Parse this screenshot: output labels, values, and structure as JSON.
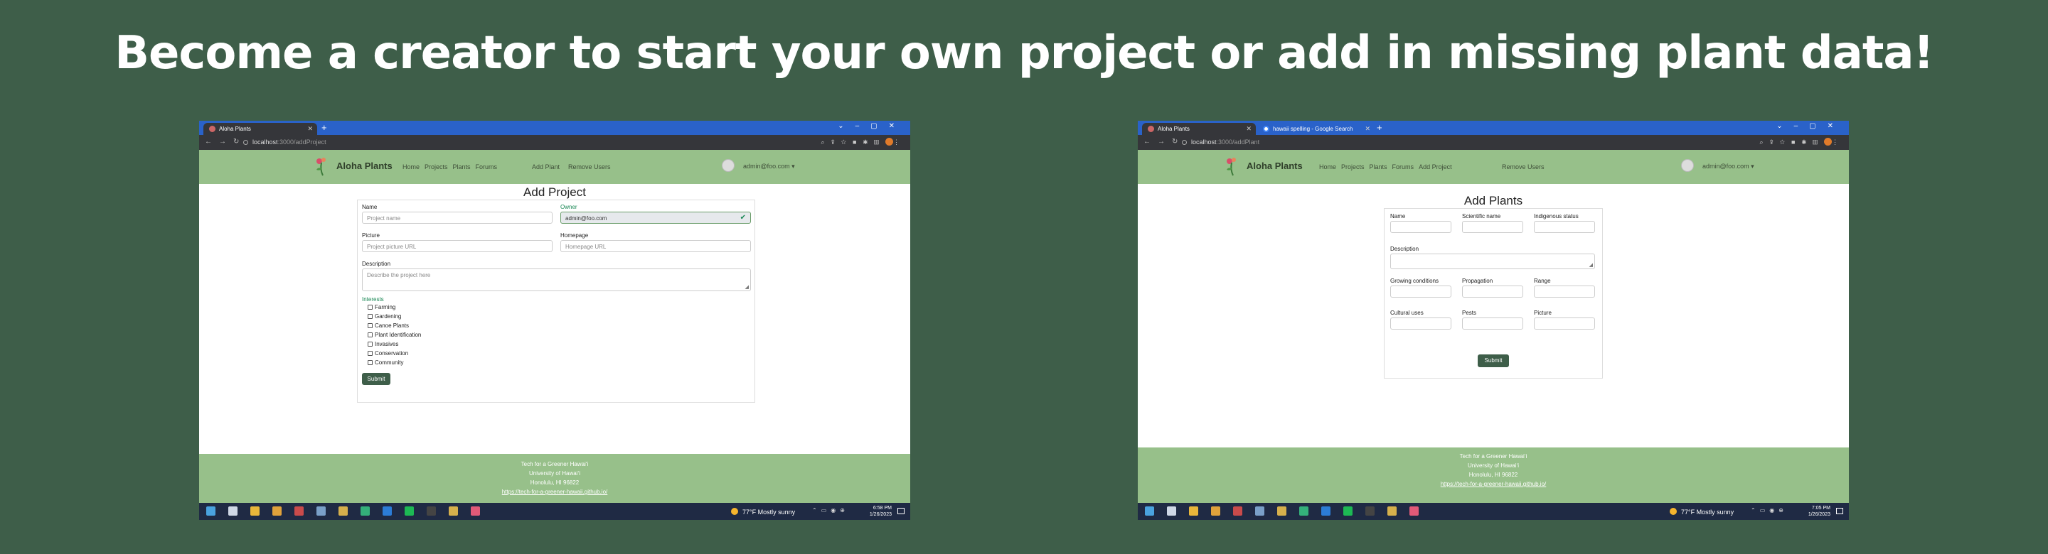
{
  "headline": "Become a creator to start your own project or add in missing plant data!",
  "left": {
    "tab_title": "Aloha Plants",
    "url_host": "localhost",
    "url_path": ":3000/addProject",
    "brand": "Aloha Plants",
    "nav": [
      "Home",
      "Projects",
      "Plants",
      "Forums"
    ],
    "nav_right": [
      "Add Plant",
      "Remove Users"
    ],
    "user": "admin@foo.com ▾",
    "page_title": "Add Project",
    "form": {
      "name_label": "Name",
      "name_placeholder": "Project name",
      "owner_label": "Owner",
      "owner_value": "admin@foo.com",
      "picture_label": "Picture",
      "picture_placeholder": "Project picture URL",
      "homepage_label": "Homepage",
      "homepage_placeholder": "Homepage URL",
      "description_label": "Description",
      "description_placeholder": "Describe the project here",
      "interests_label": "Interests",
      "interests": [
        "Farming",
        "Gardening",
        "Canoe Plants",
        "Plant Identification",
        "Invasives",
        "Conservation",
        "Community"
      ],
      "submit": "Submit"
    },
    "footer": [
      "Tech for a Greener Hawaiʻi",
      "University of Hawaiʻi",
      "Honolulu, HI 96822",
      "https://tech-for-a-greener-hawaii.github.io/"
    ],
    "weather": "77°F  Mostly sunny",
    "time": "6:58 PM",
    "date": "1/26/2023"
  },
  "right": {
    "tab_title": "Aloha Plants",
    "tab2_title": "hawaii spelling - Google Search",
    "url_host": "localhost",
    "url_path": ":3000/addPlant",
    "brand": "Aloha Plants",
    "nav": [
      "Home",
      "Projects",
      "Plants",
      "Forums",
      "Add Project"
    ],
    "nav_right": [
      "Remove Users"
    ],
    "user": "admin@foo.com ▾",
    "page_title": "Add Plants",
    "form": {
      "name_label": "Name",
      "scientific_label": "Scientific name",
      "indigenous_label": "Indigenous status",
      "description_label": "Description",
      "growing_label": "Growing conditions",
      "propagation_label": "Propagation",
      "range_label": "Range",
      "cultural_label": "Cultural uses",
      "pests_label": "Pests",
      "picture_label": "Picture",
      "submit": "Submit"
    },
    "footer": [
      "Tech for a Greener Hawaiʻi",
      "University of Hawaiʻi",
      "Honolulu, HI 96822",
      "https://tech-for-a-greener-hawaii.github.io/"
    ],
    "weather": "77°F  Mostly sunny",
    "time": "7:05 PM",
    "date": "1/26/2023"
  },
  "colors": {
    "background": "#3e5e49",
    "navbar": "#97c08a",
    "chrome_tab_bar": "#2a62c9",
    "chrome_toolbar": "#35363a",
    "submit": "#3e5e49",
    "taskbar": "#1f2a44"
  }
}
